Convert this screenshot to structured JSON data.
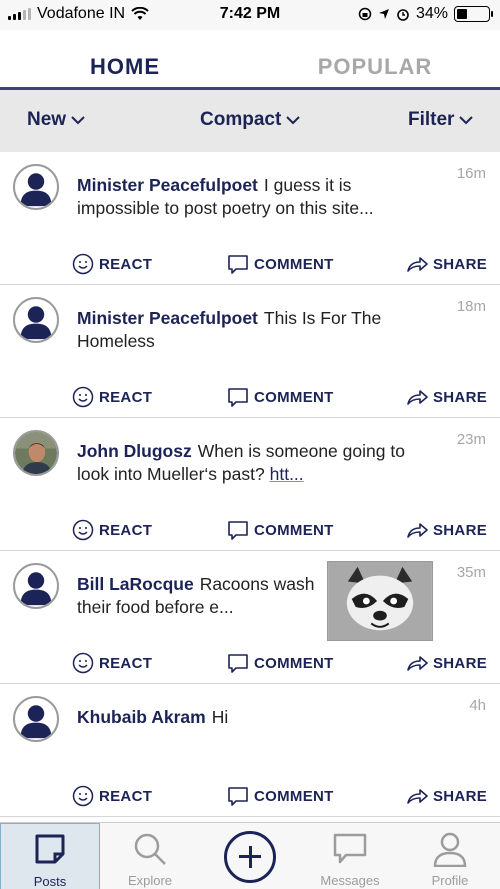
{
  "statusbar": {
    "carrier": "Vodafone IN",
    "time": "7:42 PM",
    "battery": "34%",
    "battery_level": 0.34
  },
  "tabs": {
    "home": "HOME",
    "popular": "POPULAR",
    "active": "home"
  },
  "filters": {
    "sort": "New",
    "view": "Compact",
    "filter": "Filter"
  },
  "actions": {
    "react": "REACT",
    "comment": "COMMENT",
    "share": "SHARE"
  },
  "posts": [
    {
      "author": "Minister Peacefulpoet",
      "text": "I guess it is impossible to post poetry on this site...",
      "time": "16m",
      "avatar": "default-avatar"
    },
    {
      "author": "Minister Peacefulpoet",
      "text": "This Is For The Homeless",
      "time": "18m",
      "avatar": "default-avatar"
    },
    {
      "author": "John Dlugosz",
      "text": "When is someone going to look into Mueller‘s past?",
      "link": "htt...",
      "time": "23m",
      "avatar": "photo-avatar"
    },
    {
      "author": "Bill LaRocque",
      "text": "Racoons wash their food before e...",
      "time": "35m",
      "avatar": "default-avatar",
      "thumbnail": "raccoon-image"
    },
    {
      "author": "Khubaib Akram",
      "text": "Hi",
      "time": "4h",
      "avatar": "default-avatar"
    }
  ],
  "nav": {
    "posts": "Posts",
    "explore": "Explore",
    "messages": "Messages",
    "profile": "Profile",
    "active": "posts"
  },
  "colors": {
    "accent": "#1c2357",
    "muted": "#a8a8a8",
    "filterbar": "#e8e8e8"
  }
}
